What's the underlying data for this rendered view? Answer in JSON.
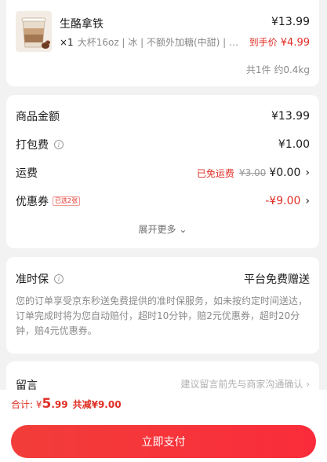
{
  "product": {
    "name": "生酪拿铁",
    "price": "¥13.99",
    "qty": "×1",
    "spec": "大杯16oz | 冰 | 不额外加糖(中甜) | 金...",
    "final_label": "到手价",
    "final_price": "¥4.99",
    "summary": "共1件 约0.4kg"
  },
  "fees": {
    "items_label": "商品金额",
    "items_value": "¥13.99",
    "packing_label": "打包费",
    "packing_value": "¥1.00",
    "shipping_label": "运费",
    "shipping_tag": "已免运费",
    "shipping_original": "¥3.00",
    "shipping_value": "¥0.00",
    "coupon_label": "优惠券",
    "coupon_tag": "已选2张",
    "coupon_value": "-¥9.00",
    "expand_label": "展开更多"
  },
  "guarantee": {
    "title": "准时保",
    "right": "平台免费赠送",
    "description": "您的订单享受京东秒送免费提供的准时保服务，如未按约定时间送达，订单完成时将为您自动赔付，超时10分钟，赔2元优惠券，超时20分钟，赔4元优惠券。"
  },
  "remark": {
    "label": "留言",
    "hint": "建议留言前先与商家沟通确认"
  },
  "footer": {
    "total_label": "合计: ¥",
    "total_int": "5",
    "total_dec": ".99",
    "saved": "共减¥9.00",
    "pay_label": "立即支付"
  },
  "colors": {
    "accent": "#e02e24",
    "button": "#f23d3a",
    "background": "#f2f2f2"
  },
  "icons": [
    "latte-cup-icon",
    "info-icon",
    "chevron-right-icon",
    "chevron-down-icon"
  ]
}
